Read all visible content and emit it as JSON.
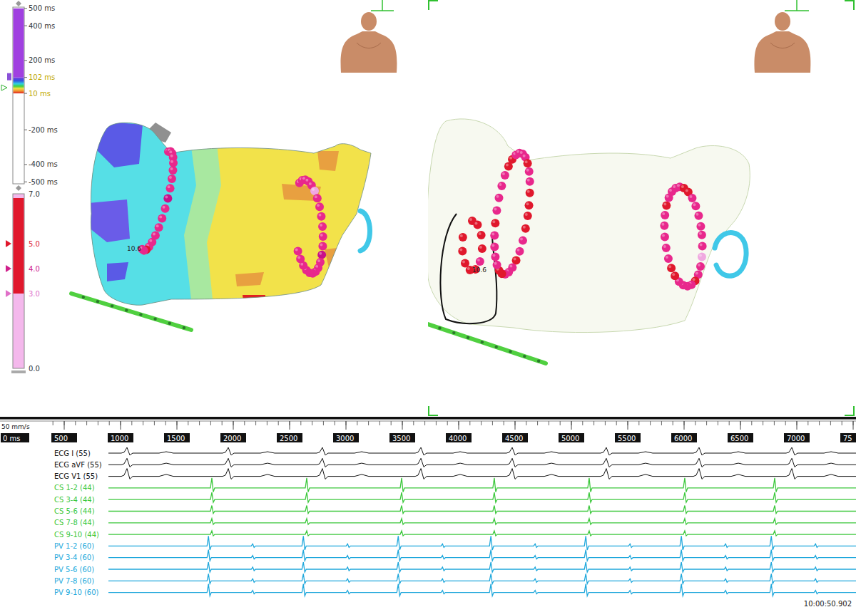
{
  "activation_scale": {
    "labels": [
      {
        "text": "500 ms",
        "highlight": false
      },
      {
        "text": "400 ms",
        "highlight": false
      },
      {
        "text": "200 ms",
        "highlight": false
      },
      {
        "text": "102 ms",
        "highlight": true
      },
      {
        "text": "10 ms",
        "highlight": true
      },
      {
        "text": "-200 ms",
        "highlight": false
      },
      {
        "text": "-400 ms",
        "highlight": false
      },
      {
        "text": "-500 ms",
        "highlight": false
      }
    ]
  },
  "force_scale": {
    "labels": [
      {
        "text": "7.0",
        "marker": false,
        "color": "#333333"
      },
      {
        "text": "5.0",
        "marker": true,
        "color": "#e0182c"
      },
      {
        "text": "4.0",
        "marker": true,
        "color": "#d0208c"
      },
      {
        "text": "3.0",
        "marker": true,
        "color": "#e070c8"
      },
      {
        "text": "0.0",
        "marker": false,
        "color": "#333333"
      }
    ]
  },
  "views": [
    {
      "kind": "activation",
      "tag_label": "10.6",
      "rings": [
        {
          "tag_colors": [
            "#e8288c",
            "#e8288c",
            "#e8288c",
            "#e8288c",
            "#e8288c",
            "#e8288c",
            "#e8288c",
            "#e8288c",
            "#c8108a",
            "#e8288c",
            "#e8288c",
            "#e8288c",
            "#e8288c",
            "#e8288c",
            "#e8288c",
            "#e0182c",
            "#e8288c",
            "#e8288c"
          ]
        },
        {
          "tag_colors": [
            "#e8288c",
            "#e8288c",
            "#e8288c",
            "#e8288c",
            "#e8288c",
            "#f0a8e0",
            "#e8288c",
            "#e8288c",
            "#e8288c",
            "#e8288c",
            "#e8288c",
            "#e8288c",
            "#c8108a",
            "#e8288c",
            "#e8288c",
            "#e8288c",
            "#e8288c",
            "#e8288c",
            "#e8288c",
            "#e8288c",
            "#e8288c",
            "#e8288c"
          ]
        }
      ]
    },
    {
      "kind": "transparent",
      "tag_label": "10.6",
      "rings": [
        {
          "tag_colors": [
            "#e0182c",
            "#e0182c",
            "#e8288c",
            "#e8288c",
            "#e0182c",
            "#e8288c",
            "#e8288c",
            "#e8288c",
            "#e0182c",
            "#e0182c",
            "#e8288c",
            "#e8288c",
            "#e8288c",
            "#e8288c",
            "#e0182c",
            "#e8288c",
            "#e8288c",
            "#e8288c",
            "#e8288c",
            "#e0182c",
            "#e0182c",
            "#e8288c",
            "#e8288c",
            "#e8288c",
            "#e8288c",
            "#e0182c",
            "#e8288c",
            "#e8288c",
            "#e0182c",
            "#e0182c"
          ]
        },
        {
          "tag_colors": [
            "#e8288c",
            "#e8288c",
            "#f0a8e0",
            "#e8288c",
            "#e8288c",
            "#e0182c",
            "#e8288c",
            "#e8288c",
            "#e8288c",
            "#e8288c",
            "#e0182c",
            "#e0182c",
            "#e8288c",
            "#e8288c",
            "#e8288c",
            "#e8288c",
            "#e8288c",
            "#e0182c",
            "#e8288c",
            "#e8288c",
            "#e8288c",
            "#e8288c",
            "#e0182c",
            "#e0182c",
            "#e8288c",
            "#e8288c",
            "#e8288c",
            "#e8288c"
          ]
        },
        {
          "tag_colors": [
            "#e0182c",
            "#e0182c",
            "#e0182c",
            "#e0182c",
            "#e8288c",
            "#e0182c",
            "#e0182c",
            "#e0182c",
            "#e0182c",
            "#e0182c"
          ]
        }
      ]
    }
  ],
  "timeline": {
    "speed": "50 mm/s",
    "origin": "0 ms",
    "ticks": [
      "500",
      "1000",
      "1500",
      "2000",
      "2500",
      "3000",
      "3500",
      "4000",
      "4500",
      "5000",
      "5500",
      "6000",
      "6500",
      "7000",
      "75"
    ]
  },
  "channels": [
    {
      "name": "ECG I (55)",
      "kind": "ecg",
      "color": "#111111",
      "amplitude": 8,
      "beats_ms": [
        1057,
        1956,
        2791,
        3665,
        4475,
        5310,
        6133,
        6956
      ]
    },
    {
      "name": "ECG aVF (55)",
      "kind": "ecg",
      "color": "#111111",
      "amplitude": 9,
      "beats_ms": [
        1057,
        1956,
        2791,
        3665,
        4475,
        5310,
        6133,
        6956
      ]
    },
    {
      "name": "ECG V1 (55)",
      "kind": "ecg",
      "color": "#111111",
      "amplitude": 11,
      "beats_ms": [
        1057,
        1956,
        2791,
        3665,
        4475,
        5310,
        6133,
        6956
      ]
    },
    {
      "name": "CS 1-2 (44)",
      "kind": "cs",
      "color": "#3cc83c",
      "amplitude": 14,
      "beats_ms": [
        924,
        1810,
        2652,
        3494,
        4316,
        5158,
        6006,
        6804
      ]
    },
    {
      "name": "CS 3-4 (44)",
      "kind": "cs",
      "color": "#3cc83c",
      "amplitude": 10,
      "beats_ms": [
        924,
        1810,
        2652,
        3494,
        4316,
        5158,
        6006,
        6804
      ]
    },
    {
      "name": "CS 5-6 (44)",
      "kind": "cs",
      "color": "#3cc83c",
      "amplitude": 8,
      "beats_ms": [
        924,
        1810,
        2652,
        3494,
        4316,
        5158,
        6006,
        6804
      ]
    },
    {
      "name": "CS 7-8 (44)",
      "kind": "cs",
      "color": "#3cc83c",
      "amplitude": 6,
      "beats_ms": [
        924,
        1810,
        2652,
        3494,
        4316,
        5158,
        6006,
        6804
      ]
    },
    {
      "name": "CS 9-10 (44)",
      "kind": "cs",
      "color": "#3cc83c",
      "amplitude": 5,
      "beats_ms": [
        924,
        1810,
        2652,
        3494,
        4316,
        5158,
        6006,
        6804
      ]
    },
    {
      "name": "PV 1-2 (60)",
      "kind": "pv",
      "color": "#20a8dc",
      "amplitude": 14,
      "beats_ms": [
        894,
        1780,
        2622,
        3464,
        4286,
        5128,
        5976,
        6774
      ]
    },
    {
      "name": "PV 3-4 (60)",
      "kind": "pv",
      "color": "#20a8dc",
      "amplitude": 11,
      "beats_ms": [
        894,
        1780,
        2622,
        3464,
        4286,
        5128,
        5976,
        6774
      ]
    },
    {
      "name": "PV 5-6 (60)",
      "kind": "pv",
      "color": "#20a8dc",
      "amplitude": 10,
      "beats_ms": [
        894,
        1780,
        2622,
        3464,
        4286,
        5128,
        5976,
        6774
      ]
    },
    {
      "name": "PV 7-8 (60)",
      "kind": "pv",
      "color": "#20a8dc",
      "amplitude": 10,
      "beats_ms": [
        894,
        1780,
        2622,
        3464,
        4286,
        5128,
        5976,
        6774
      ]
    },
    {
      "name": "PV 9-10 (60)",
      "kind": "pv",
      "color": "#20a8dc",
      "amplitude": 12,
      "beats_ms": [
        894,
        1780,
        2622,
        3464,
        4286,
        5128,
        5976,
        6774
      ]
    }
  ],
  "timestamp": "10:00:50.902"
}
